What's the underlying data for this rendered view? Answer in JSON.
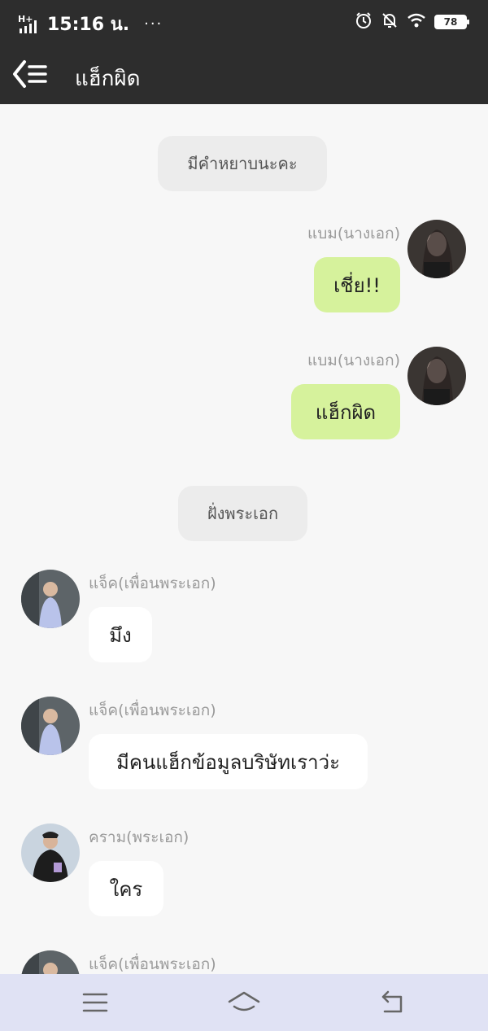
{
  "status_bar": {
    "network": "H+",
    "time": "15:16 น.",
    "more": "···",
    "battery": "78"
  },
  "header": {
    "title": "แฮ็กผิด"
  },
  "messages": {
    "system_1": "มีคำหยาบนะคะ",
    "sender_1": "แบม(นางเอก)",
    "bubble_1": "เชี่ย!!",
    "sender_2": "แบม(นางเอก)",
    "bubble_2": "แฮ็กผิด",
    "system_2": "ฝั่งพระเอก",
    "sender_3": "แจ็ค(เพื่อนพระเอก)",
    "bubble_3": "มึง",
    "sender_4": "แจ็ค(เพื่อนพระเอก)",
    "bubble_4": "มีคนแฮ็กข้อมูลบริษัทเราว่ะ",
    "sender_5": "คราม(พระเอก)",
    "bubble_5": "ใคร",
    "sender_6": "แจ็ค(เพื่อนพระเอก)"
  },
  "colors": {
    "header_bg": "#2d2d2d",
    "chat_bg": "#f7f7f7",
    "outgoing_bubble": "#d6f29c",
    "incoming_bubble": "#ffffff",
    "nav_bg": "#e0e2f4"
  },
  "icons": {
    "back": "back-menu-icon",
    "alarm": "alarm-icon",
    "mute": "bell-off-icon",
    "wifi": "wifi-icon",
    "nav_menu": "menu-icon",
    "nav_home": "home-icon",
    "nav_back": "return-icon"
  }
}
